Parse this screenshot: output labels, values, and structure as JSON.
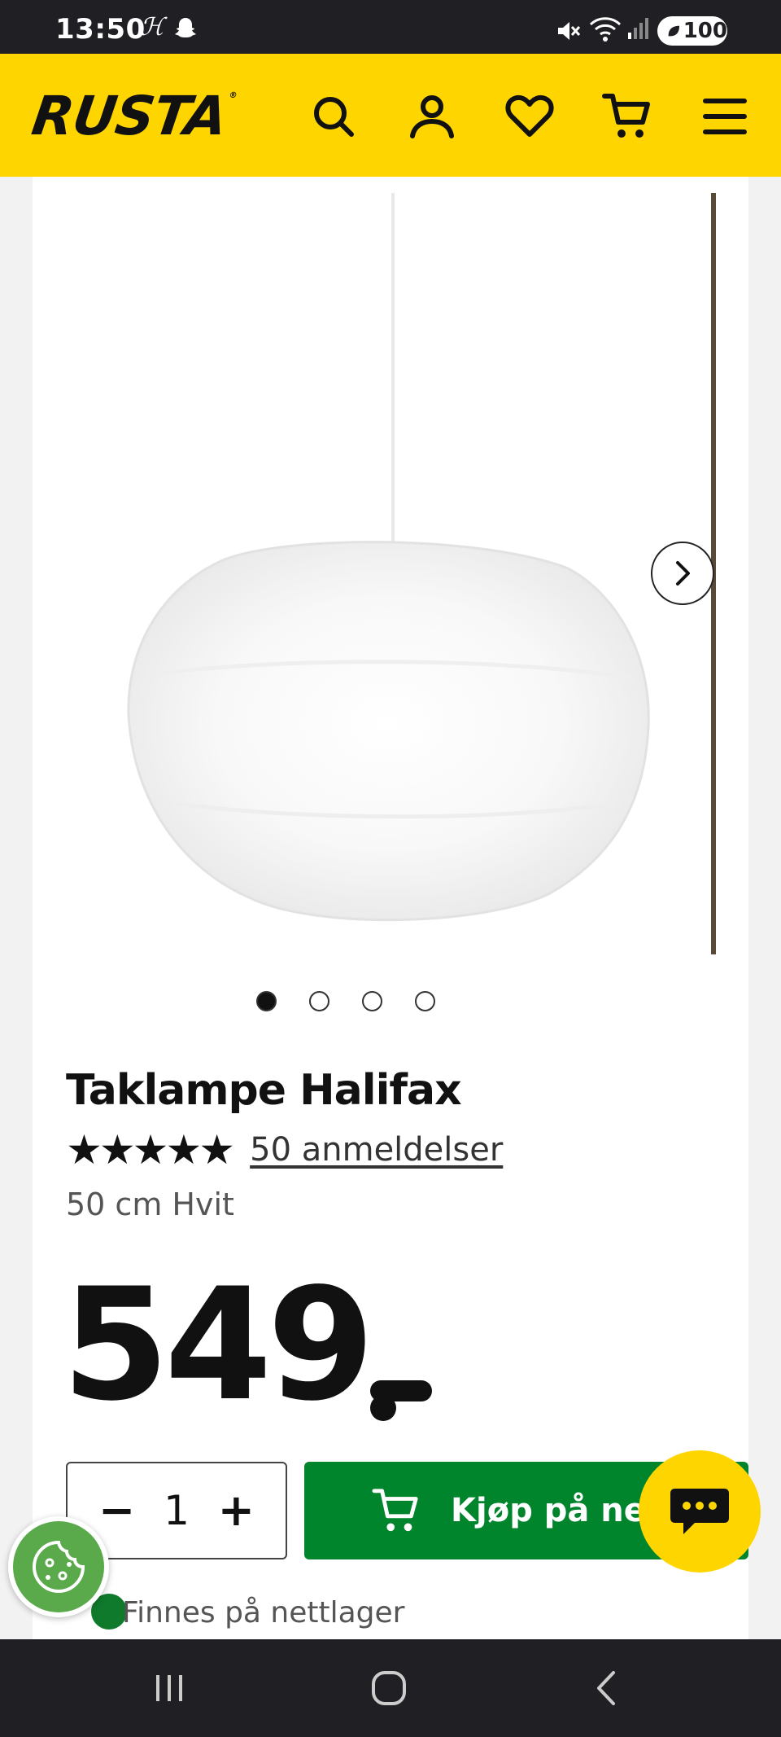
{
  "status_bar": {
    "time": "13:50",
    "h_glyph": "ℋ",
    "battery": "100",
    "icons": [
      "snapchat-ghost-icon",
      "mute-icon",
      "wifi-icon",
      "signal-icon",
      "battery-icon"
    ]
  },
  "header": {
    "logo": "RUSTA",
    "logo_mark": "®",
    "background": "#ffd500",
    "icons": [
      "search-icon",
      "account-icon",
      "heart-icon",
      "cart-icon",
      "menu-icon"
    ]
  },
  "gallery": {
    "slide_count": 4,
    "active_index": 0
  },
  "product": {
    "title": "Taklampe Halifax",
    "stars": "★★★★★",
    "rating": 5,
    "reviews_label": "50 anmeldelser",
    "variant": "50 cm Hvit",
    "price": "549"
  },
  "purchase": {
    "qty_minus": "−",
    "qty_value": "1",
    "qty_plus": "+",
    "buy_label": "Kjøp på nett",
    "buy_color": "#00852c",
    "stock_text": "Finnes på nettlager"
  },
  "nav_bar": {
    "icons": [
      "recent-apps-icon",
      "home-icon",
      "back-icon"
    ]
  }
}
